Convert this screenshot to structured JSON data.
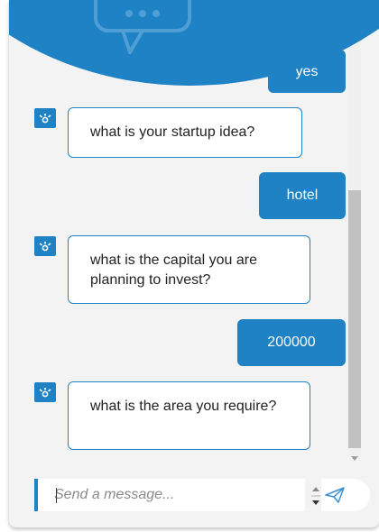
{
  "header": {
    "partial_text": "yes",
    "icon": "chat-bubble-icon",
    "color": "#1e82c4"
  },
  "messages": [
    {
      "from": "bot",
      "text": "what is your startup idea?"
    },
    {
      "from": "user",
      "text": "hotel"
    },
    {
      "from": "bot",
      "text": "what is the capital you are planning to invest?"
    },
    {
      "from": "user",
      "text": "200000"
    },
    {
      "from": "bot",
      "text": "what is the area you require?"
    }
  ],
  "composer": {
    "placeholder": "Send a message...",
    "send_icon": "paper-plane-icon"
  },
  "colors": {
    "accent": "#1e82c4",
    "bot_bubble_bg": "#ffffff",
    "user_bubble_text": "#ffffff",
    "panel_bg": "#f3f3f3"
  }
}
